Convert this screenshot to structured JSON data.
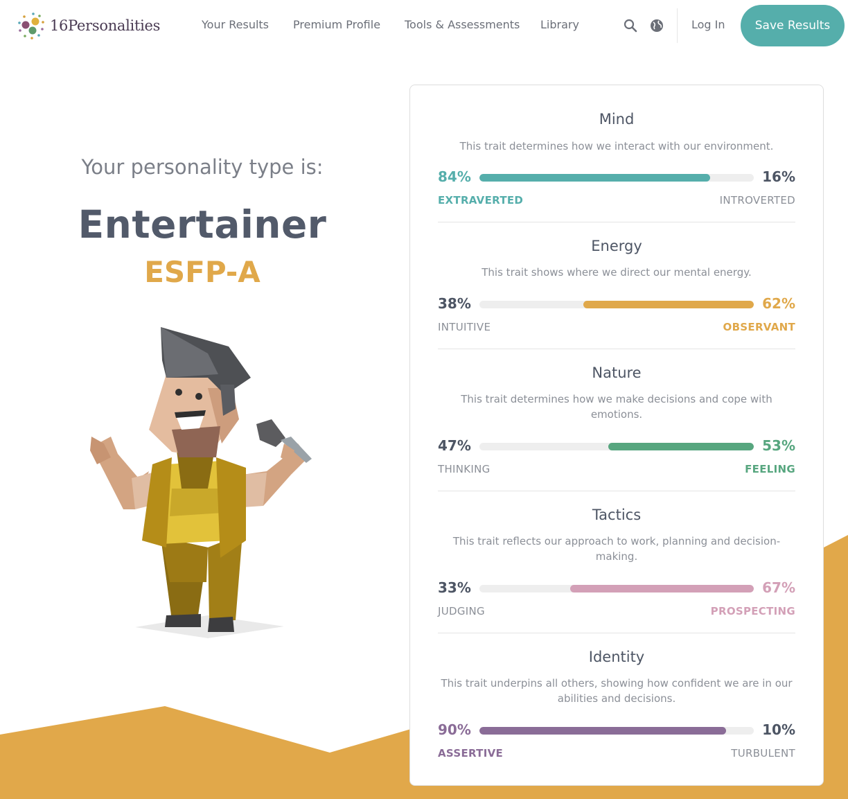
{
  "header": {
    "logo_text": "16Personalities",
    "nav": [
      "Your Results",
      "Premium Profile",
      "Tools & Assessments",
      "Library"
    ],
    "login_label": "Log In",
    "save_label": "Save Results"
  },
  "hero": {
    "lead": "Your personality type is:",
    "type_name": "Entertainer",
    "type_code": "ESFP-A"
  },
  "colors": {
    "teal": "#55aeab",
    "gold": "#e0a84a",
    "green": "#57a67f",
    "pink": "#d3a0b7",
    "purple": "#8a6c97",
    "gray_text": "#576071"
  },
  "traits": [
    {
      "title": "Mind",
      "description": "This trait determines how we interact with our environment.",
      "left_pct": "84%",
      "right_pct": "16%",
      "left_label": "EXTRAVERTED",
      "right_label": "INTROVERTED",
      "fill_fraction": 0.84,
      "fill_side": "left",
      "color": "#55aeab"
    },
    {
      "title": "Energy",
      "description": "This trait shows where we direct our mental energy.",
      "left_pct": "38%",
      "right_pct": "62%",
      "left_label": "INTUITIVE",
      "right_label": "OBSERVANT",
      "fill_fraction": 0.62,
      "fill_side": "right",
      "color": "#e0a84a"
    },
    {
      "title": "Nature",
      "description": "This trait determines how we make decisions and cope with emotions.",
      "left_pct": "47%",
      "right_pct": "53%",
      "left_label": "THINKING",
      "right_label": "FEELING",
      "fill_fraction": 0.53,
      "fill_side": "right",
      "color": "#57a67f"
    },
    {
      "title": "Tactics",
      "description": "This trait reflects our approach to work, planning and decision-making.",
      "left_pct": "33%",
      "right_pct": "67%",
      "left_label": "JUDGING",
      "right_label": "PROSPECTING",
      "fill_fraction": 0.67,
      "fill_side": "right",
      "color": "#d3a0b7"
    },
    {
      "title": "Identity",
      "description": "This trait underpins all others, showing how confident we are in our abilities and decisions.",
      "left_pct": "90%",
      "right_pct": "10%",
      "left_label": "ASSERTIVE",
      "right_label": "TURBULENT",
      "fill_fraction": 0.9,
      "fill_side": "left",
      "color": "#8a6c97"
    }
  ]
}
